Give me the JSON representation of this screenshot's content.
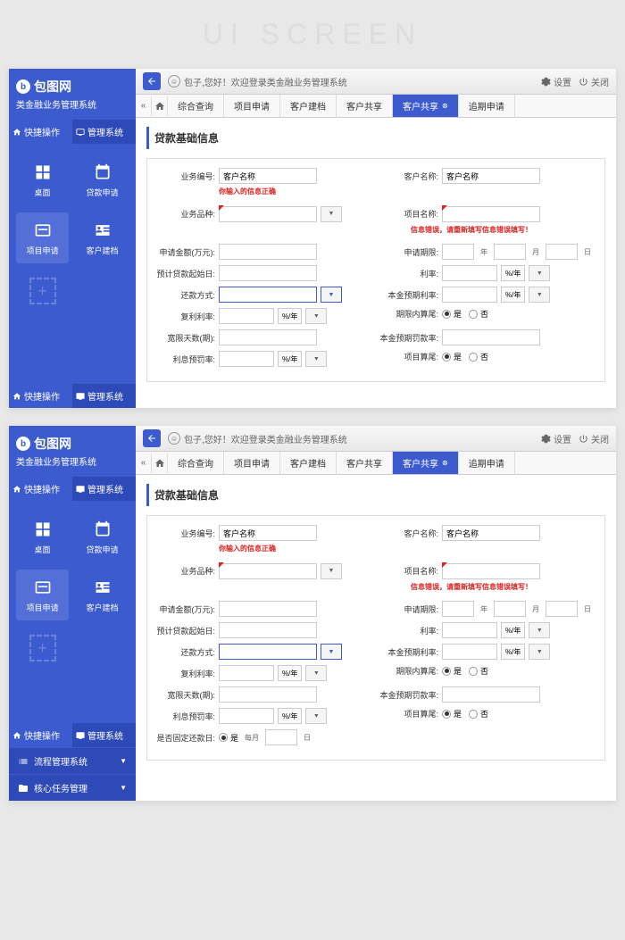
{
  "page_title": "UI SCREEN",
  "logo": {
    "icon": "b",
    "text": "包图网",
    "subtitle": "类金融业务管理系统"
  },
  "sidebar_tabs": {
    "quick": "快捷操作",
    "manage": "管理系统"
  },
  "quick_items": [
    {
      "label": "桌面",
      "icon": "grid"
    },
    {
      "label": "贷款申请",
      "icon": "calendar"
    },
    {
      "label": "项目申请",
      "icon": "card"
    },
    {
      "label": "客户建档",
      "icon": "profile"
    }
  ],
  "sidebar_menu": [
    {
      "label": "流程管理系统",
      "icon": "list"
    },
    {
      "label": "核心任务管理",
      "icon": "folder"
    }
  ],
  "topbar": {
    "welcome": "包子,您好！欢迎登录类金融业务管理系统",
    "settings": "设置",
    "close": "关闭"
  },
  "tabs": [
    {
      "label": "综合查询"
    },
    {
      "label": "项目申请"
    },
    {
      "label": "客户建档"
    },
    {
      "label": "客户共享"
    },
    {
      "label": "客户共享",
      "active": true,
      "closable": true
    },
    {
      "label": "追期申请"
    }
  ],
  "section_title": "贷款基础信息",
  "form": {
    "left": {
      "biz_no": {
        "label": "业务编号:",
        "value": "客户名称",
        "hint": "你输入的信息正确"
      },
      "biz_type": {
        "label": "业务品种:"
      },
      "apply_amount": {
        "label": "申请金额(万元):"
      },
      "loan_start": {
        "label": "预计贷款起始日:"
      },
      "repay_method": {
        "label": "还款方式:"
      },
      "compound_rate": {
        "label": "复利利率:",
        "unit": "%/年"
      },
      "grace_days": {
        "label": "宽限天数(期):"
      },
      "penalty_rate": {
        "label": "利息预罚率:",
        "unit": "%/年"
      },
      "fixed_repay": {
        "label": "是否固定还款日:",
        "yes": "是",
        "per_month": "每月",
        "day": "日"
      }
    },
    "right": {
      "client_name": {
        "label": "客户名称:",
        "value": "客户名称"
      },
      "project_name": {
        "label": "项目名称:",
        "hint": "信息错误，请重新填写信息错误填写！"
      },
      "apply_period": {
        "label": "申请期限:",
        "year": "年",
        "month": "月",
        "day": "日"
      },
      "rate": {
        "label": "利率:",
        "unit": "%/年"
      },
      "principal_rate": {
        "label": "本金预期利率:",
        "unit": "%/年"
      },
      "period_settle": {
        "label": "期限内算尾:",
        "yes": "是",
        "no": "否"
      },
      "principal_penalty": {
        "label": "本金预期罚款率:"
      },
      "project_settle": {
        "label": "项目算尾:",
        "yes": "是",
        "no": "否"
      }
    }
  }
}
